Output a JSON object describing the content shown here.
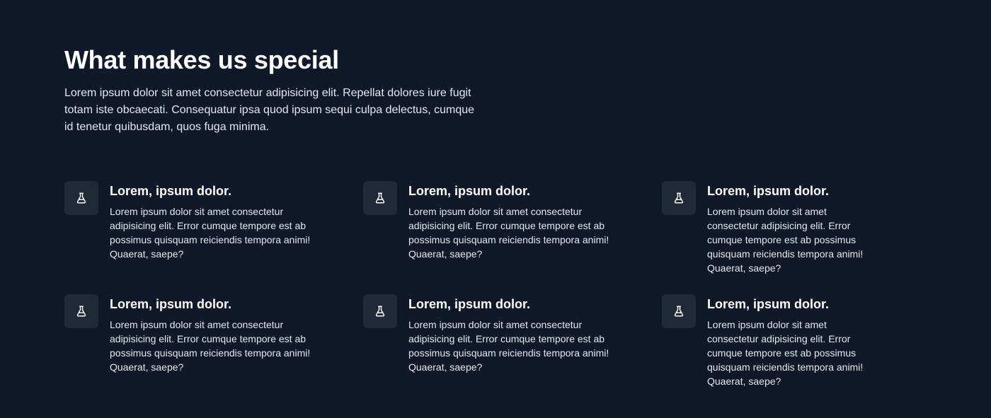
{
  "section": {
    "title": "What makes us special",
    "intro": "Lorem ipsum dolor sit amet consectetur adipisicing elit. Repellat dolores iure fugit totam iste obcaecati. Consequatur ipsa quod ipsum sequi culpa delectus, cumque id tenetur quibusdam, quos fuga minima."
  },
  "theme": {
    "background": "#111827",
    "icon_tile": "#1f2937",
    "text": "#e5e7eb",
    "heading": "#ffffff"
  },
  "features": [
    {
      "icon": "flask-icon",
      "title": "Lorem, ipsum dolor.",
      "text": "Lorem ipsum dolor sit amet consectetur adipisicing elit. Error cumque tempore est ab possimus quisquam reiciendis tempora animi! Quaerat, saepe?"
    },
    {
      "icon": "flask-icon",
      "title": "Lorem, ipsum dolor.",
      "text": "Lorem ipsum dolor sit amet consectetur adipisicing elit. Error cumque tempore est ab possimus quisquam reiciendis tempora animi! Quaerat, saepe?"
    },
    {
      "icon": "flask-icon",
      "title": "Lorem, ipsum dolor.",
      "text": "Lorem ipsum dolor sit amet consectetur adipisicing elit. Error cumque tempore est ab possimus quisquam reiciendis tempora animi! Quaerat, saepe?"
    },
    {
      "icon": "flask-icon",
      "title": "Lorem, ipsum dolor.",
      "text": "Lorem ipsum dolor sit amet consectetur adipisicing elit. Error cumque tempore est ab possimus quisquam reiciendis tempora animi! Quaerat, saepe?"
    },
    {
      "icon": "flask-icon",
      "title": "Lorem, ipsum dolor.",
      "text": "Lorem ipsum dolor sit amet consectetur adipisicing elit. Error cumque tempore est ab possimus quisquam reiciendis tempora animi! Quaerat, saepe?"
    },
    {
      "icon": "flask-icon",
      "title": "Lorem, ipsum dolor.",
      "text": "Lorem ipsum dolor sit amet consectetur adipisicing elit. Error cumque tempore est ab possimus quisquam reiciendis tempora animi! Quaerat, saepe?"
    }
  ]
}
